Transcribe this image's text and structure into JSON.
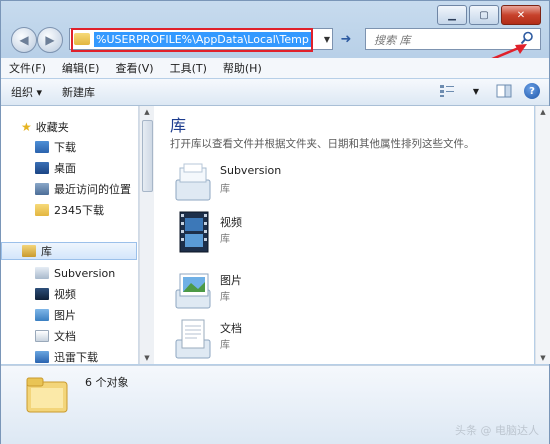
{
  "address": {
    "path": "%USERPROFILE%\\AppData\\Local\\Temp"
  },
  "search": {
    "placeholder": "搜索 库"
  },
  "menu": [
    "文件(F)",
    "编辑(E)",
    "查看(V)",
    "工具(T)",
    "帮助(H)"
  ],
  "toolbar": {
    "organize": "组织 ▾",
    "new_library": "新建库"
  },
  "nav": {
    "favorites_label": "收藏夹",
    "favorites": [
      "下载",
      "桌面",
      "最近访问的位置",
      "2345下载"
    ],
    "library_label": "库",
    "libraries": [
      "Subversion",
      "视频",
      "图片",
      "文档",
      "迅雷下载"
    ]
  },
  "content": {
    "title": "库",
    "description": "打开库以查看文件并根据文件夹、日期和其他属性排列这些文件。",
    "items": [
      {
        "name": "Subversion",
        "type": "库"
      },
      {
        "name": "视频",
        "type": "库"
      },
      {
        "name": "图片",
        "type": "库"
      },
      {
        "name": "文档",
        "type": "库"
      }
    ]
  },
  "details": {
    "count": "6 个对象"
  },
  "watermark": "头条 @ 电脑达人",
  "colors": {
    "accent": "#3399ff",
    "annotation": "#e0212b",
    "title": "#1e3d8f"
  }
}
